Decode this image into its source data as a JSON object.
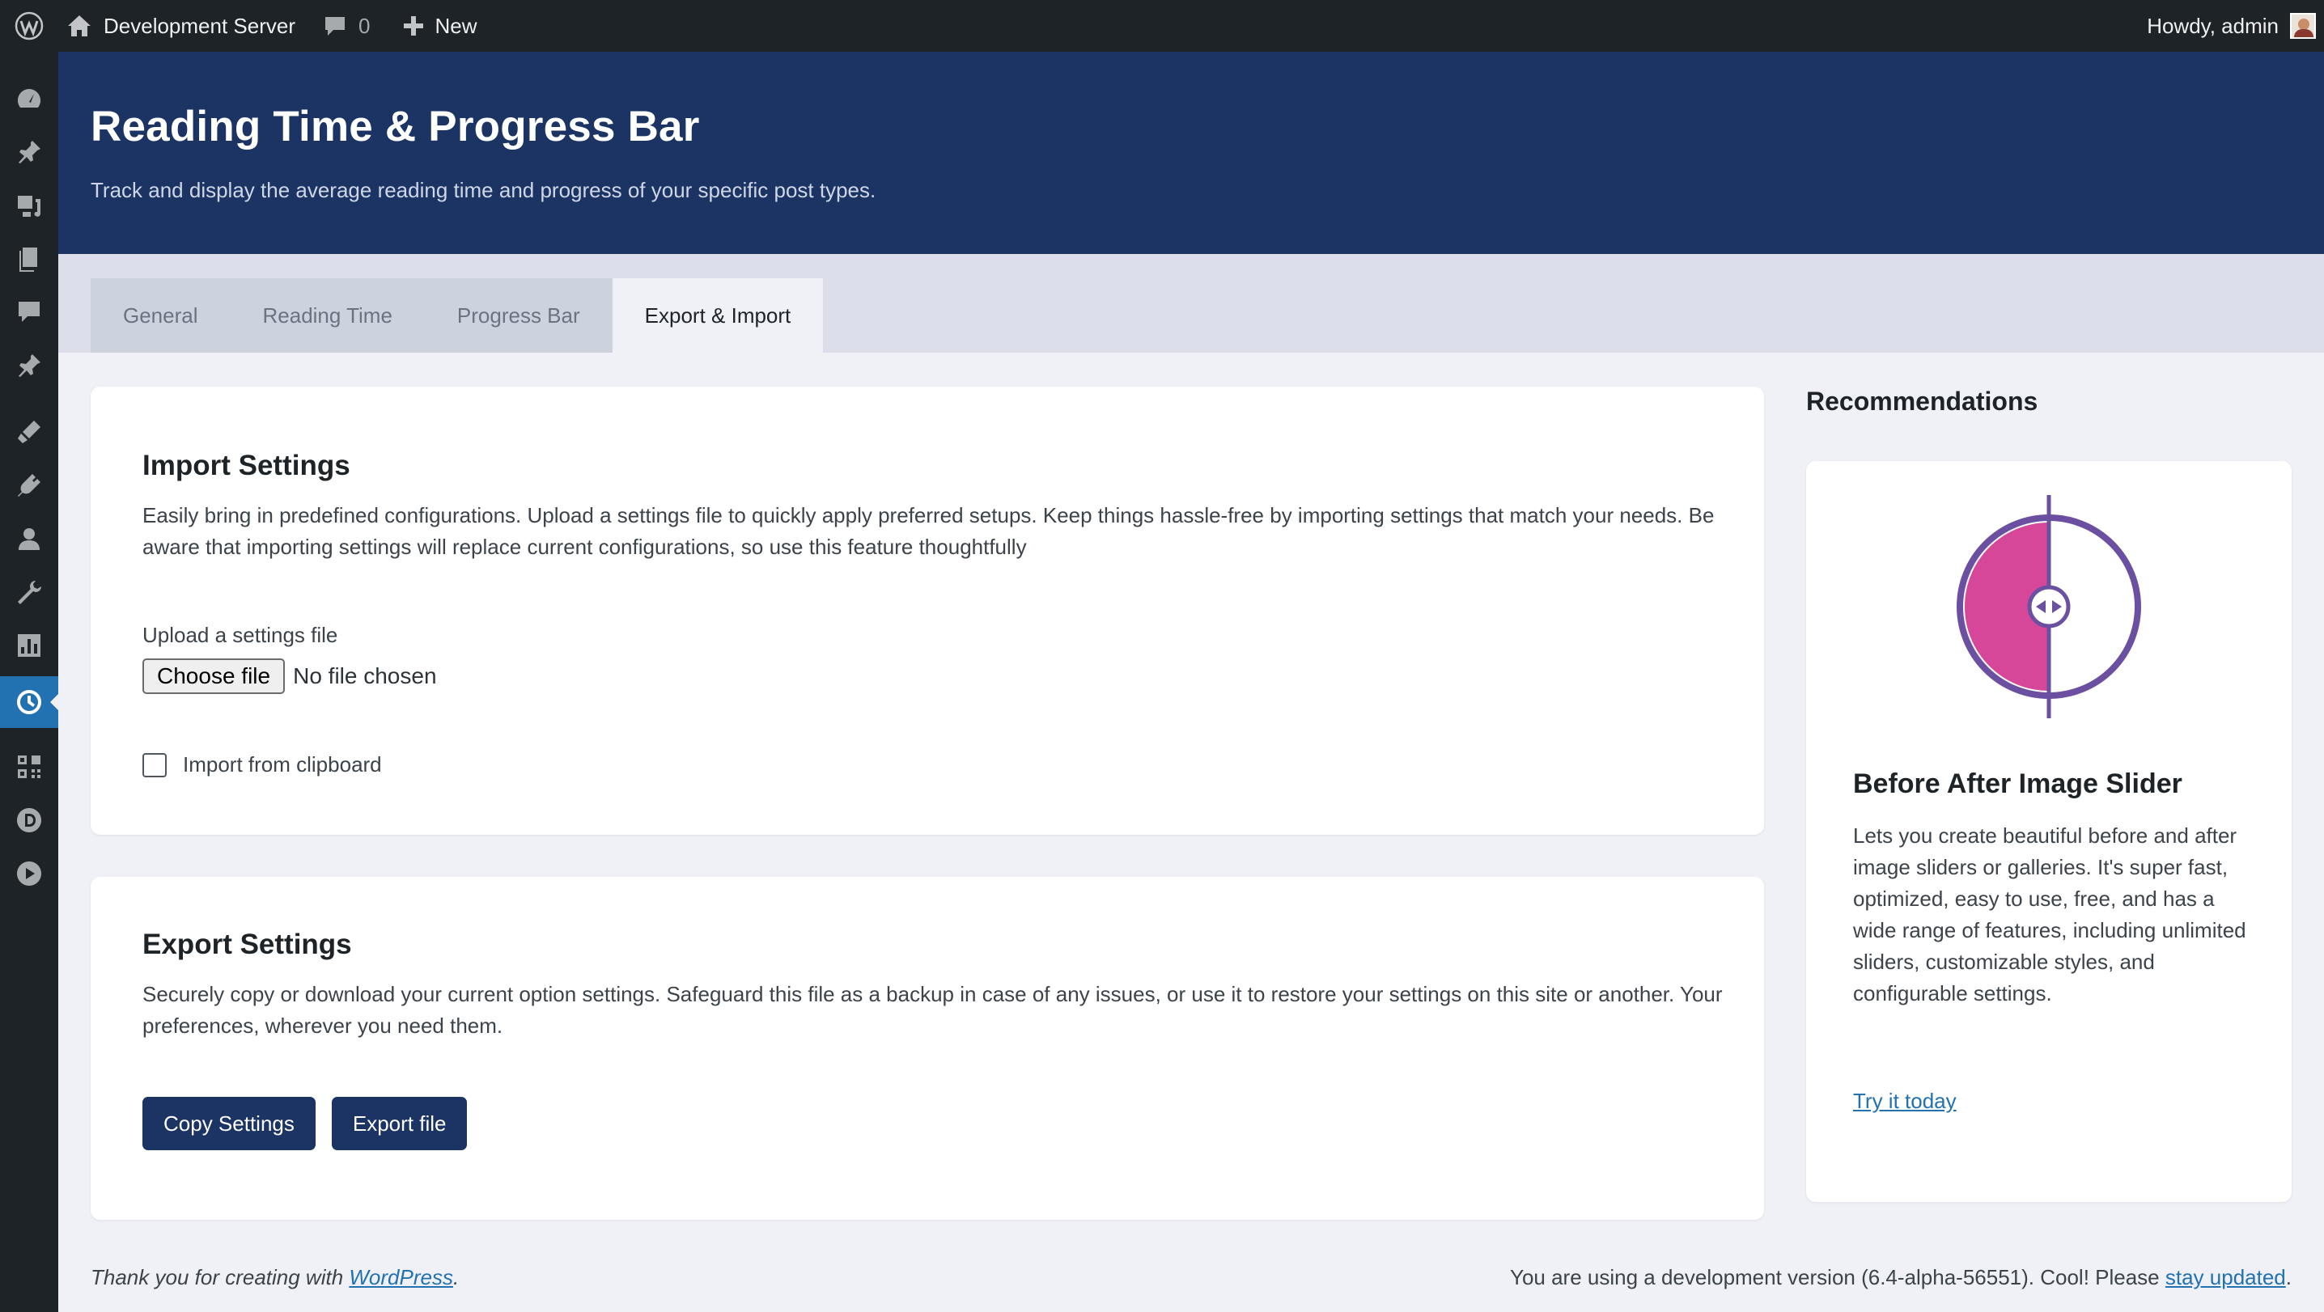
{
  "admin_bar": {
    "site_name": "Development Server",
    "comments_count": "0",
    "new_label": "New",
    "greeting": "Howdy, admin"
  },
  "admin_menu": {
    "icons": [
      "dashboard-icon",
      "posts-icon",
      "media-icon",
      "pages-icon",
      "comments-icon",
      "pin-icon",
      "appearance-icon",
      "plugins-icon",
      "users-icon",
      "tools-icon",
      "settings-icon",
      "clock-icon",
      "grid-icon",
      "d-icon",
      "play-icon"
    ],
    "current": "clock-icon"
  },
  "header": {
    "title": "Reading Time & Progress Bar",
    "subtitle": "Track and display the average reading time and progress of your specific post types."
  },
  "tabs": [
    {
      "label": "General",
      "active": false
    },
    {
      "label": "Reading Time",
      "active": false
    },
    {
      "label": "Progress Bar",
      "active": false
    },
    {
      "label": "Export & Import",
      "active": true
    }
  ],
  "import": {
    "title": "Import Settings",
    "description": "Easily bring in predefined configurations. Upload a settings file to quickly apply preferred setups. Keep things hassle-free by importing settings that match your needs. Be aware that importing settings will replace current configurations, so use this feature thoughtfully",
    "upload_label": "Upload a settings file",
    "choose_file_label": "Choose file",
    "no_file_text": "No file chosen",
    "clipboard_label": "Import from clipboard",
    "clipboard_checked": false
  },
  "export": {
    "title": "Export Settings",
    "description": "Securely copy or download your current option settings. Safeguard this file as a backup in case of any issues, or use it to restore your settings on this site or another. Your preferences, wherever you need them.",
    "copy_button": "Copy Settings",
    "export_button": "Export file"
  },
  "recommendations": {
    "heading": "Recommendations",
    "product_title": "Before After Image Slider",
    "product_description": "Lets you create beautiful before and after image sliders or galleries. It's super fast, optimized, easy to use, free, and has a wide range of features, including unlimited sliders, customizable styles, and configurable settings.",
    "link_label": "Try it today",
    "logo_colors": {
      "ring": "#6b4fa0",
      "fill": "#d6479a"
    }
  },
  "footer": {
    "left_prefix": "Thank you for creating with ",
    "left_link": "WordPress",
    "left_suffix": ".",
    "right_prefix": "You are using a development version (6.4-alpha-56551). Cool! Please ",
    "right_link": "stay updated",
    "right_suffix": "."
  },
  "colors": {
    "header_bg": "#1b3463",
    "button_bg": "#1b3463",
    "admin_bar_bg": "#1d2327",
    "menu_current": "#2271b1",
    "link": "#2271b1"
  }
}
